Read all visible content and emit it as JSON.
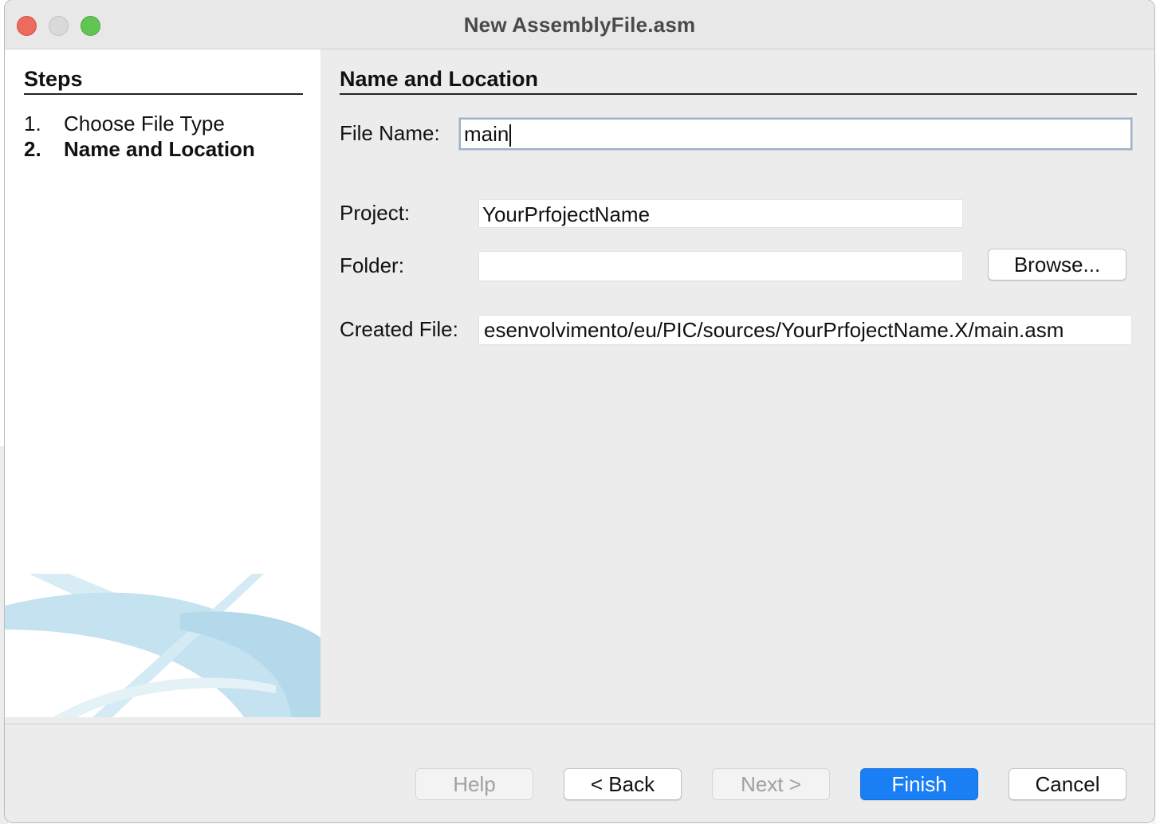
{
  "window": {
    "title": "New AssemblyFile.asm"
  },
  "steps": {
    "heading": "Steps",
    "items": [
      {
        "number": "1.",
        "label": "Choose File Type",
        "current": false
      },
      {
        "number": "2.",
        "label": "Name and Location",
        "current": true
      }
    ]
  },
  "panel": {
    "heading": "Name and Location",
    "file_name_label": "File Name:",
    "file_name_value": "main",
    "project_label": "Project:",
    "project_value": "YourPrfojectName",
    "folder_label": "Folder:",
    "folder_value": "",
    "browse_label": "Browse...",
    "created_file_label": "Created File:",
    "created_file_value": "esenvolvimento/eu/PIC/sources/YourPrfojectName.X/main.asm"
  },
  "buttons": {
    "help": "Help",
    "back": "< Back",
    "next": "Next >",
    "finish": "Finish",
    "cancel": "Cancel"
  },
  "colors": {
    "accent": "#1a7ff5",
    "close": "#ed6a5e",
    "maximize": "#61c554"
  }
}
